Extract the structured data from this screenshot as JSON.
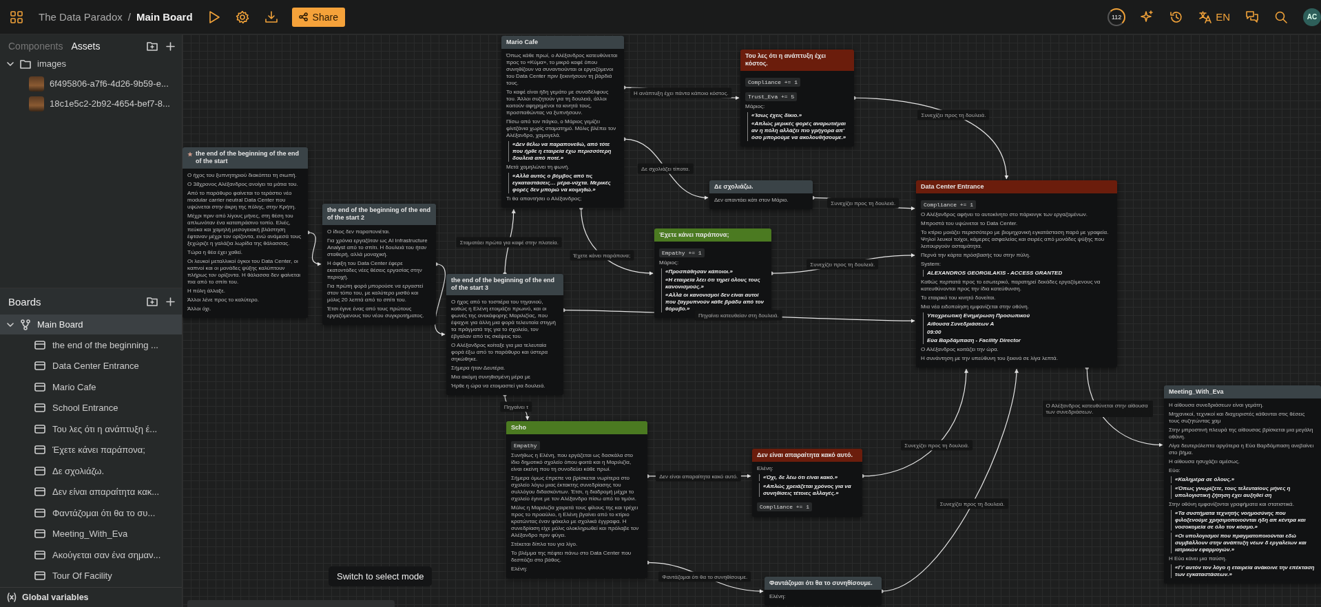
{
  "topbar": {
    "project": "The Data Paradox",
    "separator": "/",
    "board": "Main Board",
    "share": "Share",
    "credits": "112",
    "language": "EN",
    "avatar": "AC"
  },
  "sidebar": {
    "tabs": [
      {
        "label": "Components",
        "selected": false
      },
      {
        "label": "Assets",
        "selected": true
      }
    ],
    "assets": [
      {
        "name": "images",
        "expanded": true,
        "children": [
          {
            "name": "6f495806-a7f6-4d26-9b59-e..."
          },
          {
            "name": "18c1e5c2-2b92-4654-bef7-8..."
          }
        ]
      }
    ],
    "boards_title": "Boards",
    "boards": [
      {
        "name": "Main Board",
        "expanded": true,
        "selected": true,
        "children": [
          {
            "name": "the end of the beginning ..."
          },
          {
            "name": "Data Center Entrance"
          },
          {
            "name": "Mario Cafe"
          },
          {
            "name": "School Entrance"
          },
          {
            "name": "Του λες ότι η ανάπτυξη έ..."
          },
          {
            "name": "Έχετε κάνει παράπονα;"
          },
          {
            "name": "Δε σχολιάζω."
          },
          {
            "name": "Δεν είναι απαραίτητα κακ..."
          },
          {
            "name": "Φαντάζομαι ότι θα το συ..."
          },
          {
            "name": "Meeting_With_Eva"
          },
          {
            "name": "Ακούγεται σαν ένα σημαν..."
          },
          {
            "name": "Tour Of Facility"
          }
        ]
      }
    ],
    "footer": "Global variables"
  },
  "canvas": {
    "nodes": [
      {
        "title": "Mario Cafe",
        "color": "#3a4347",
        "starred": false,
        "blocks": [
          {
            "kind": "text",
            "text": "Όπως κάθε πρωί, ο Αλέξανδρος κατευθύνεται προς το «Κύμα», το μικρό καφέ όπου συνηθίζουν να συναντιούνται οι εργαζόμενοι του Data Center πριν ξεκινήσουν τη βάρδιά τους."
          },
          {
            "kind": "text",
            "text": "Το καφέ είναι ήδη γεμάτο με συναδέλφους του. Άλλοι συζητούν για τη δουλειά, άλλοι κοιτούν αφηρημένοι τα κινητά τους, προσπαθώντας να ξυπνήσουν."
          },
          {
            "kind": "text",
            "text": "Πίσω από τον πάγκο, ο Μάριος γεμίζει φλιτζάνια χωρίς σταματημό. Μόλις βλέπει τον Αλέξανδρο, χαμογελά."
          },
          {
            "kind": "quote",
            "lines": [
              "«Δεν θέλω να παραπονεθώ, από τότε που ήρθε η εταιρεία έχω περισσότερη δουλειά από ποτέ.»"
            ]
          },
          {
            "kind": "text",
            "text": "Μετά χαμηλώνει τη φωνή."
          },
          {
            "kind": "quote",
            "lines": [
              "«Αλλά αυτός ο βόμβος από τις εγκαταστάσεις… μέρα-νύχτα. Μερικές φορές δεν μπορώ να κοιμηθώ.»"
            ]
          },
          {
            "kind": "text",
            "text": "Τι θα απαντήσει ο Αλέξανδρος;"
          }
        ]
      },
      {
        "title": "Του λες ότι η ανάπτυξη έχει κόστος.",
        "color": "#6b1d0c",
        "starred": false,
        "blocks": [
          {
            "kind": "code",
            "text": "Compliance += 1"
          },
          {
            "kind": "code",
            "text": "Trust_Eva += 5"
          },
          {
            "kind": "text",
            "text": "Μάριος:"
          },
          {
            "kind": "quote",
            "lines": [
              "«Ίσως έχεις δίκιο.»",
              "«Απλώς μερικές φορές αναρωτιέμαι αν η πόλη αλλάζει πιο γρήγορα απ' όσο μπορούμε να ακολουθήσουμε.»"
            ]
          }
        ]
      },
      {
        "title": "the end of the beginning of the end of the start",
        "color": "#3a4347",
        "starred": true,
        "blocks": [
          {
            "kind": "text",
            "text": "Ο ήχος του ξυπνητηριού διακόπτει τη σιωπή."
          },
          {
            "kind": "text",
            "text": "Ο 38χρονος Αλέξανδρος ανοίγει τα μάτια του."
          },
          {
            "kind": "text",
            "text": "Από το παράθυρο φαίνεται το τεράστιο νέο modular carrier neutral Data Center που υψώνεται στην άκρη της πόλης, στην Κρήτη."
          },
          {
            "kind": "text",
            "text": "Μέχρι πριν από λίγους μήνες, στη θέση του απλωνόταν ένα καταπράσινο τοπίο. Ελιές, πεύκα και χαμηλή μεσογειακή βλάστηση έφταναν μέχρι τον ορίζοντα, ενώ ανάμεσά τους ξεχώριζε η γαλάζια λωρίδα της θάλασσας."
          },
          {
            "kind": "text",
            "text": "Τώρα η θέα έχει χαθεί."
          },
          {
            "kind": "text",
            "text": "Οι λευκοί μεταλλικοί όγκοι του Data Center, οι καπνοί και οι μονάδες ψύξης καλύπτουν πλήρως τον ορίζοντα. Η θάλασσα δεν φαίνεται πια από το σπίτι του."
          },
          {
            "kind": "text",
            "text": "Η πόλη άλλαξε."
          },
          {
            "kind": "text",
            "text": "Άλλοι λένε προς το καλύτερο."
          },
          {
            "kind": "text",
            "text": "Άλλοι όχι."
          }
        ]
      },
      {
        "title": "Δε σχολιάζω.",
        "color": "#3a4347",
        "starred": false,
        "blocks": [
          {
            "kind": "text",
            "text": "Δεν απαντάει κάτι στον Μάριο."
          }
        ]
      },
      {
        "title": "the end of the beginning of the end of the start 2",
        "color": "#3a4347",
        "starred": false,
        "blocks": [
          {
            "kind": "text",
            "text": "Ο ίδιος δεν παραπονιέται."
          },
          {
            "kind": "text",
            "text": "Για χρόνια εργαζόταν ως AI Infrastructure Analyst από το σπίτι. Η δουλειά του ήταν σταθερή, αλλά μοναχική."
          },
          {
            "kind": "text",
            "text": "Η άφιξη του Data Center έφερε εκατοντάδες νέες θέσεις εργασίας στην περιοχή."
          },
          {
            "kind": "text",
            "text": "Για πρώτη φορά μπορούσε να εργαστεί στον τόπο του, με καλύτερο μισθό και μόλις 20 λεπτά από το σπίτι του."
          },
          {
            "kind": "text",
            "text": "Έτσι έγινε ένας από τους πρώτους εργαζόμενους του νέου συγκροτήματος."
          }
        ]
      },
      {
        "title": "Έχετε κάνει παράπονα;",
        "color": "#4b7a21",
        "starred": false,
        "blocks": [
          {
            "kind": "code",
            "text": "Empathy += 1"
          },
          {
            "kind": "text",
            "text": "Μάριος:"
          },
          {
            "kind": "quote",
            "lines": [
              "«Προσπάθησαν κάποιοι.»",
              "«Η εταιρεία λέει ότι τηρεί όλους τους κανονισμούς.»",
              "«Αλλά οι κανονισμοί δεν είναι αυτοί που ξαγρυπνούν κάθε βράδυ από τον θόρυβο.»"
            ]
          }
        ]
      },
      {
        "title": "Data Center Entrance",
        "color": "#6b1d0c",
        "starred": false,
        "blocks": [
          {
            "kind": "code",
            "text": "Compliance += 1"
          },
          {
            "kind": "text",
            "text": "Ο Αλέξανδρος αφήνει το αυτοκίνητο στο πάρκινγκ των εργαζομένων."
          },
          {
            "kind": "text",
            "text": "Μπροστά του υψώνεται το Data Center."
          },
          {
            "kind": "text",
            "text": "Το κτίριο μοιάζει περισσότερο με βιομηχανική εγκατάσταση παρά με γραφεία. Ψηλοί λευκοί τοίχοι, κάμερες ασφαλείας και σειρές από μονάδες ψύξης που λειτουργούν ασταμάτητα."
          },
          {
            "kind": "text",
            "text": "Περνά την κάρτα πρόσβασής του στην πύλη."
          },
          {
            "kind": "text",
            "text": "System:"
          },
          {
            "kind": "quote",
            "lines": [
              "ALEXANDROS GEORGILAKIS - ACCESS GRANTED"
            ]
          },
          {
            "kind": "text",
            "text": "Καθώς περπατά προς το εσωτερικό, παρατηρεί δεκάδες εργαζόμενους να κατευθύνονται προς την ίδια κατεύθυνση."
          },
          {
            "kind": "text",
            "text": "Το εταιρικό του κινητό δονείται."
          },
          {
            "kind": "text",
            "text": "Μια νέα ειδοποίηση εμφανίζεται στην οθόνη."
          },
          {
            "kind": "quote",
            "lines": [
              "Υποχρεωτική Ενημέρωση Προσωπικού",
              "Αίθουσα Συνεδριάσεων Α",
              "09:00",
              "Εύα Βαρδάμπαση - Facility Director"
            ]
          },
          {
            "kind": "text",
            "text": "Ο Αλέξανδρος κοιτάζει την ώρα."
          },
          {
            "kind": "text",
            "text": "Η συνάντηση με την υπεύθυνη του ξεκινά σε λίγα λεπτά."
          }
        ]
      },
      {
        "title": "the end of the beginning of the end of the start 3",
        "color": "#3a4347",
        "starred": false,
        "blocks": [
          {
            "kind": "text",
            "text": "Ο ήχος από το τοστιέρα του τηγανιού, καθώς η Ελένη ετοιμάζει πρωινό, και οι φωνές της ανεκάφορης Μαριλιζίας, που έψαχνε για άλλη μια φορά τελευταία στιγμή τα πράγματά της για το σχολείο, τον έβγαλαν από τις σκέψεις του."
          },
          {
            "kind": "text",
            "text": "Ο Αλέξανδρος κοίταξε για μια τελευταία φορά έξω από το παράθυρο και ύστερα σηκώθηκε."
          },
          {
            "kind": "text",
            "text": "Σήμερα ήταν Δευτέρα."
          },
          {
            "kind": "text",
            "text": "Μια ακόμη συνηθισμένη μέρα με"
          },
          {
            "kind": "text",
            "text": "Ήρθε η ώρα να ετοιμαστεί για δουλειά."
          }
        ]
      },
      {
        "title": "Scho",
        "color": "#4b7a21",
        "starred": false,
        "blocks": [
          {
            "kind": "code",
            "text": "Empathy"
          },
          {
            "kind": "text",
            "text": "Συνήθως η Ελένη, που εργάζεται ως δασκάλα στο ίδιο δημοτικό σχολείο όπου φοιτά και η Μαριλιζία, είναι εκείνη που τη συνοδεύει κάθε πρωί."
          },
          {
            "kind": "text",
            "text": "Σήμερα όμως έπρεπε να βρίσκεται νωρίτερα στο σχολείο λόγω μιας έκτακτης συνεδρίασης του συλλόγου διδασκόντων. Έτσι, η διαδρομή μέχρι το σχολείο έγινε με τον Αλέξανδρο πίσω από το τιμόνι."
          },
          {
            "kind": "text",
            "text": "Μόλις η Μαριλιζία χαιρετά τους φίλους της και τρέχει προς το προαύλιο, η Ελένη βγαίνει από το κτίριο κρατώντας έναν φάκελο με σχολικά έγγραφα. Η συνεδρίαση είχε μόλις ολοκληρωθεί και πρόλαβε τον Αλέξανδρο πριν φύγει."
          },
          {
            "kind": "text",
            "text": "Στέκεται δίπλα του για λίγο."
          },
          {
            "kind": "text",
            "text": "Το βλέμμα της πέφτει πάνω στο Data Center που δεσπόζει στο βάθος."
          },
          {
            "kind": "text",
            "text": "Ελένη:"
          }
        ]
      },
      {
        "title": "Δεν είναι απαραίτητα κακό αυτό.",
        "color": "#6b1d0c",
        "starred": false,
        "blocks": [
          {
            "kind": "text",
            "text": "Ελένη:"
          },
          {
            "kind": "quote",
            "lines": [
              "«Όχι, δε λέω ότι είναι κακό.»"
            ]
          },
          {
            "kind": "quote",
            "lines": [
              "«Απλώς χρειάζεται χρόνος για να συνηθίσεις τέτοιες αλλαγές.»"
            ]
          },
          {
            "kind": "code",
            "text": "Compliance += 1"
          }
        ]
      },
      {
        "title": "Meeting_With_Eva",
        "color": "#3a4347",
        "starred": false,
        "blocks": [
          {
            "kind": "text",
            "text": "Η αίθουσα συνεδριάσεων είναι γεμάτη."
          },
          {
            "kind": "text",
            "text": "Μηχανικοί, τεχνικοί και διαχειριστές κάθονται στις θέσεις τους συζητώντας χαμ"
          },
          {
            "kind": "text",
            "text": "Στην μπροστινή πλευρά της αίθουσας βρίσκεται μια μεγάλη οθόνη."
          },
          {
            "kind": "text",
            "text": "Λίγα δευτερόλεπτα αργότερα η Εύα Βαρδάμπαση ανεβαίνει στο βήμα."
          },
          {
            "kind": "text",
            "text": "Η αίθουσα ησυχάζει αμέσως."
          },
          {
            "kind": "text",
            "text": "Εύα:"
          },
          {
            "kind": "quote",
            "lines": [
              "«Καλημέρα σε όλους.»"
            ]
          },
          {
            "kind": "quote",
            "lines": [
              "«Όπως γνωρίζετε, τους τελευταίους μήνες η υπολογιστική ζήτηση έχει αυξηθεί ση"
            ]
          },
          {
            "kind": "text",
            "text": "Στην οθόνη εμφανίζονται γραφήματα και στατιστικά."
          },
          {
            "kind": "quote",
            "lines": [
              "«Τα συστήματα τεχνητής νοημοσύνης που φιλοξενούμε χρησιμοποιούνται ήδη απ κέντρα και νοσοκομεία σε όλο τον κόσμο.»"
            ]
          },
          {
            "kind": "quote",
            "lines": [
              "«Οι υπολογισμοί που πραγματοποιούνται εδώ συμβάλλουν στην ανάπτυξη νέων δ εργαλείων και ιατρικών εφαρμογών.»"
            ]
          },
          {
            "kind": "text",
            "text": "Η Εύα κάνει μια παύση."
          },
          {
            "kind": "quote",
            "lines": [
              "«Γι' αυτόν τον λόγο η εταιρεία ανάκοινε την επέκταση των εγκαταστάσεων.»"
            ]
          }
        ]
      },
      {
        "title": "Φαντάζομαι ότι θα το συνηθίσουμε.",
        "color": "#3a4347",
        "starred": false,
        "blocks": [
          {
            "kind": "text",
            "text": "Ελένη:"
          }
        ]
      }
    ],
    "edges": [
      {
        "label": "Η ανάπτυξη έχει πάντα κάποιο κόστος."
      },
      {
        "label": "Συνεχίζει προς τη δουλειά."
      },
      {
        "label": "Δε σχολιάζει τίποτα."
      },
      {
        "label": "Συνεχίζει προς τη δουλειά."
      },
      {
        "label": "Σταματάει πρώτα για καφέ στην πλατεία."
      },
      {
        "label": "Έχετε κάνει παράπονα;"
      },
      {
        "label": "Συνεχίζει προς τη δουλειά."
      },
      {
        "label": "Πηγαίνει κατευθείαν στη δουλειά."
      },
      {
        "label": "Πηγαίνει τ"
      },
      {
        "label": "Δεν είναι απαραίτητα κακό αυτό."
      },
      {
        "label": "Συνεχίζει προς τη δουλειά."
      },
      {
        "label": "Ο Αλέξανδρος κατευθύνεται στην αίθουσα των συνεδριάσεων."
      },
      {
        "label": "Συνεχίζει προς τη δουλειά."
      },
      {
        "label": "Φαντάζομαι ότι θα το συνηθίσουμε."
      }
    ],
    "tooltip": "Switch to select mode"
  }
}
